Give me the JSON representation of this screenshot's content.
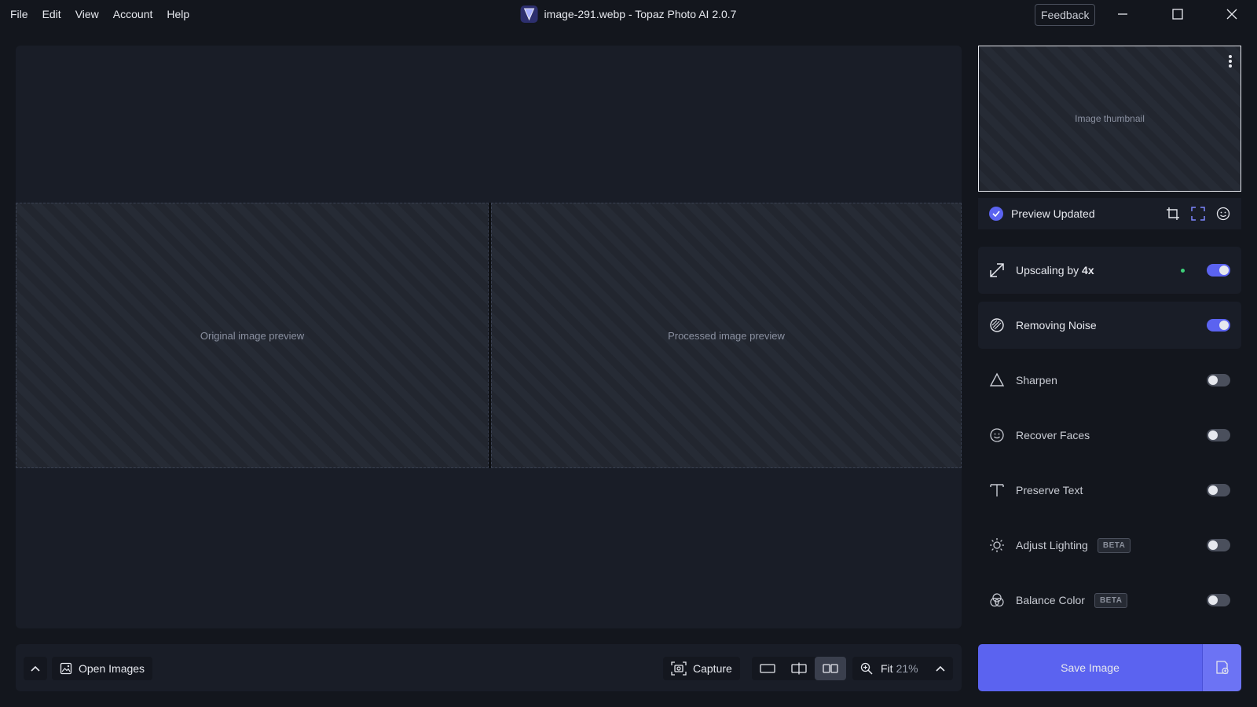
{
  "menu": [
    "File",
    "Edit",
    "View",
    "Account",
    "Help"
  ],
  "window": {
    "title": "image-291.webp - Topaz Photo AI 2.0.7",
    "feedback_label": "Feedback"
  },
  "canvas": {
    "original_placeholder": "Original image preview",
    "processed_placeholder": "Processed image preview"
  },
  "thumbnail": {
    "placeholder": "Image thumbnail"
  },
  "preview": {
    "status": "Preview Updated"
  },
  "filters": [
    {
      "label": "Upscaling by ",
      "label_emphasis": "4x",
      "enabled": true,
      "icon": "upscale-icon"
    },
    {
      "label": "Removing Noise",
      "enabled": true,
      "icon": "noise-icon"
    },
    {
      "label": "Sharpen",
      "enabled": false,
      "icon": "triangle-icon"
    },
    {
      "label": "Recover Faces",
      "enabled": false,
      "icon": "face-icon"
    },
    {
      "label": "Preserve Text",
      "enabled": false,
      "icon": "text-icon"
    },
    {
      "label": "Adjust Lighting",
      "badge": "BETA",
      "enabled": false,
      "icon": "sun-icon"
    },
    {
      "label": "Balance Color",
      "badge": "BETA",
      "enabled": false,
      "icon": "color-icon"
    }
  ],
  "bottom": {
    "open_images": "Open Images",
    "capture": "Capture",
    "zoom_label": "Fit",
    "zoom_pct": "21%"
  },
  "save": {
    "label": "Save Image"
  },
  "colors": {
    "accent": "#5b63f0",
    "bg": "#13161d",
    "panel": "#191d27"
  }
}
